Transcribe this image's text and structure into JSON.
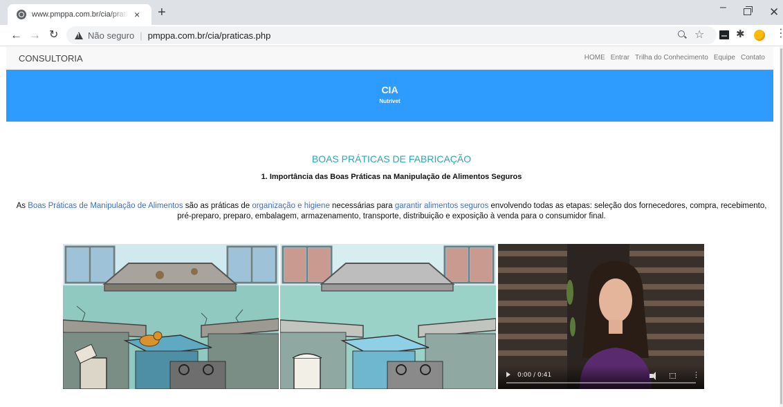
{
  "browser": {
    "tab_title": "www.pmppa.com.br/cia/praticas.php",
    "tab_close_icon": "×",
    "new_tab_icon": "+",
    "not_secure_label": "Não seguro",
    "url": "pmppa.com.br/cia/praticas.php",
    "icons": [
      "back-icon",
      "forward-icon",
      "reload-icon",
      "warning-icon",
      "zoom-icon",
      "star-icon",
      "extension-icon",
      "puzzle-icon",
      "profile-icon",
      "menu-icon"
    ]
  },
  "site_nav": {
    "brand": "CONSULTORIA",
    "links": [
      "HOME",
      "Entrar",
      "Trilha do Conhecimento",
      "Equipe",
      "Contato"
    ]
  },
  "hero": {
    "title": "CIA",
    "subtitle": "Nutrivet",
    "color": "#2e9bff"
  },
  "content": {
    "section_title": "BOAS PRÁTICAS DE FABRICAÇÃO",
    "section_subtitle": "1. Importância das Boas Práticas na Manipulação de Alimentos Seguros",
    "intro": {
      "p1": "As ",
      "h1": "Boas Práticas de Manipulação de Alimentos",
      "p2": " são as práticas de ",
      "h2": "organização e higiene",
      "p3": " necessárias para ",
      "h3": "garantir alimentos seguros",
      "p4": " envolvendo todas as etapas: seleção dos fornecedores, compra, recebimento, pré-preparo, preparo, embalagem, armazenamento, transporte, distribuição e exposição à venda para o consumidor final."
    },
    "title_color": "#2ba6b5",
    "highlight_color": "#3b6fc9"
  },
  "video": {
    "time": "0:00 / 0:41",
    "progress": 0
  }
}
